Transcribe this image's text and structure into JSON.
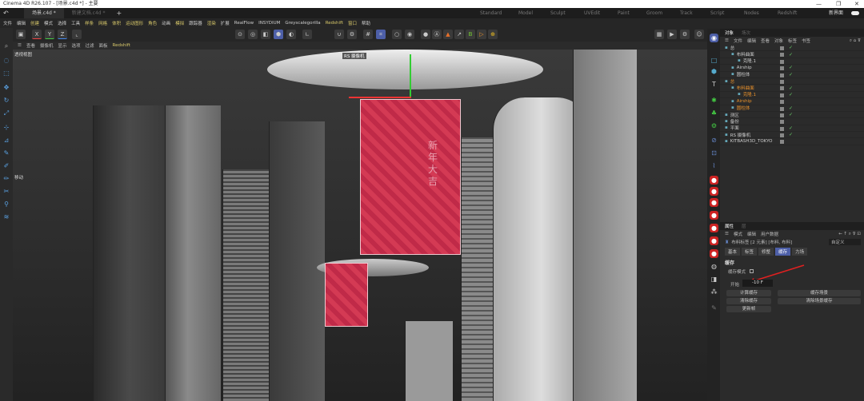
{
  "window": {
    "title": "Cinema 4D R26.107 - [场景.c4d *] - 主要",
    "minimize": "—",
    "maximize": "❐",
    "close": "✕"
  },
  "doc_tabs": [
    {
      "label": "场景.c4d *",
      "active": true
    },
    {
      "label": "新建文档.c4d *",
      "active": false
    }
  ],
  "layouts": [
    "Standard",
    "Model",
    "Sculpt",
    "UVEdit",
    "Paint",
    "Groom",
    "Track",
    "Script",
    "Nodes",
    "Redshift"
  ],
  "new_ui_label": "新界面",
  "menu": [
    {
      "label": "文件"
    },
    {
      "label": "编辑"
    },
    {
      "label": "创建",
      "y": true
    },
    {
      "label": "模式"
    },
    {
      "label": "选择"
    },
    {
      "label": "工具"
    },
    {
      "label": "样条",
      "y": true
    },
    {
      "label": "网格",
      "y": true
    },
    {
      "label": "体积",
      "y": true
    },
    {
      "label": "运动图形",
      "y": true
    },
    {
      "label": "角色",
      "y": true
    },
    {
      "label": "动画"
    },
    {
      "label": "模拟",
      "y": true
    },
    {
      "label": "跟踪器"
    },
    {
      "label": "渲染",
      "y": true
    },
    {
      "label": "扩展"
    },
    {
      "label": "RealFlow"
    },
    {
      "label": "INSYDIUM"
    },
    {
      "label": "Greyscalegorilla"
    },
    {
      "label": "Redshift",
      "y": true
    },
    {
      "label": "窗口",
      "y": true
    },
    {
      "label": "帮助"
    }
  ],
  "axes": {
    "x": "X",
    "y": "Y",
    "z": "Z"
  },
  "viewport_menu": [
    "查看",
    "摄像机",
    "显示",
    "选项",
    "过滤",
    "面板",
    "Redshift"
  ],
  "viewport": {
    "name": "透视视图",
    "camera_label": "RS 摄像机",
    "move_label": "移动",
    "flag_text": "新年大吉"
  },
  "object_manager": {
    "tabs": [
      "对象",
      "场次"
    ],
    "menu": [
      "文件",
      "编辑",
      "查看",
      "对象",
      "标签",
      "书签"
    ],
    "objects": [
      {
        "name": "总",
        "indent": 0
      },
      {
        "name": "布料曲面",
        "indent": 1
      },
      {
        "name": "克隆.1",
        "indent": 2
      },
      {
        "name": "Airship",
        "indent": 1
      },
      {
        "name": "圆柱体",
        "indent": 1
      },
      {
        "name": "总",
        "indent": 0,
        "orange": true
      },
      {
        "name": "布料曲面",
        "indent": 1,
        "orange": true
      },
      {
        "name": "克隆.1",
        "indent": 2,
        "orange": true
      },
      {
        "name": "Airship",
        "indent": 1,
        "orange": true
      },
      {
        "name": "圆柱体",
        "indent": 1,
        "orange": true
      },
      {
        "name": "测区",
        "indent": 0
      },
      {
        "name": "备份",
        "indent": 0
      },
      {
        "name": "平面",
        "indent": 0
      },
      {
        "name": "RS 摄像机",
        "indent": 0
      },
      {
        "name": "KITBASH3D_TOKYO",
        "indent": 0
      }
    ]
  },
  "attributes": {
    "tabs": [
      "属性",
      "层"
    ],
    "menu": [
      "模式",
      "编辑",
      "用户数据"
    ],
    "object_label": "布料标签 [2 元素] [布料, 布料]",
    "preset": "自定义",
    "subtabs": [
      {
        "label": "基本"
      },
      {
        "label": "标签"
      },
      {
        "label": "修整"
      },
      {
        "label": "缓存",
        "active": true
      },
      {
        "label": "力场"
      }
    ],
    "section": "缓存",
    "cache_mode_label": "缓存模式",
    "start_label": "开始",
    "start_value": "-10 F",
    "buttons": {
      "calc_cache": "计算缓存",
      "cache_scene": "缓存场景",
      "clear_cache": "清除缓存",
      "clear_scene_cache": "清除场景缓存",
      "update_frame": "更新帧"
    }
  },
  "colors": {
    "accent": "#4d5fa8",
    "flag": "#d43a54",
    "highlight_text": "#e8902a",
    "arrow": "#e02020"
  }
}
